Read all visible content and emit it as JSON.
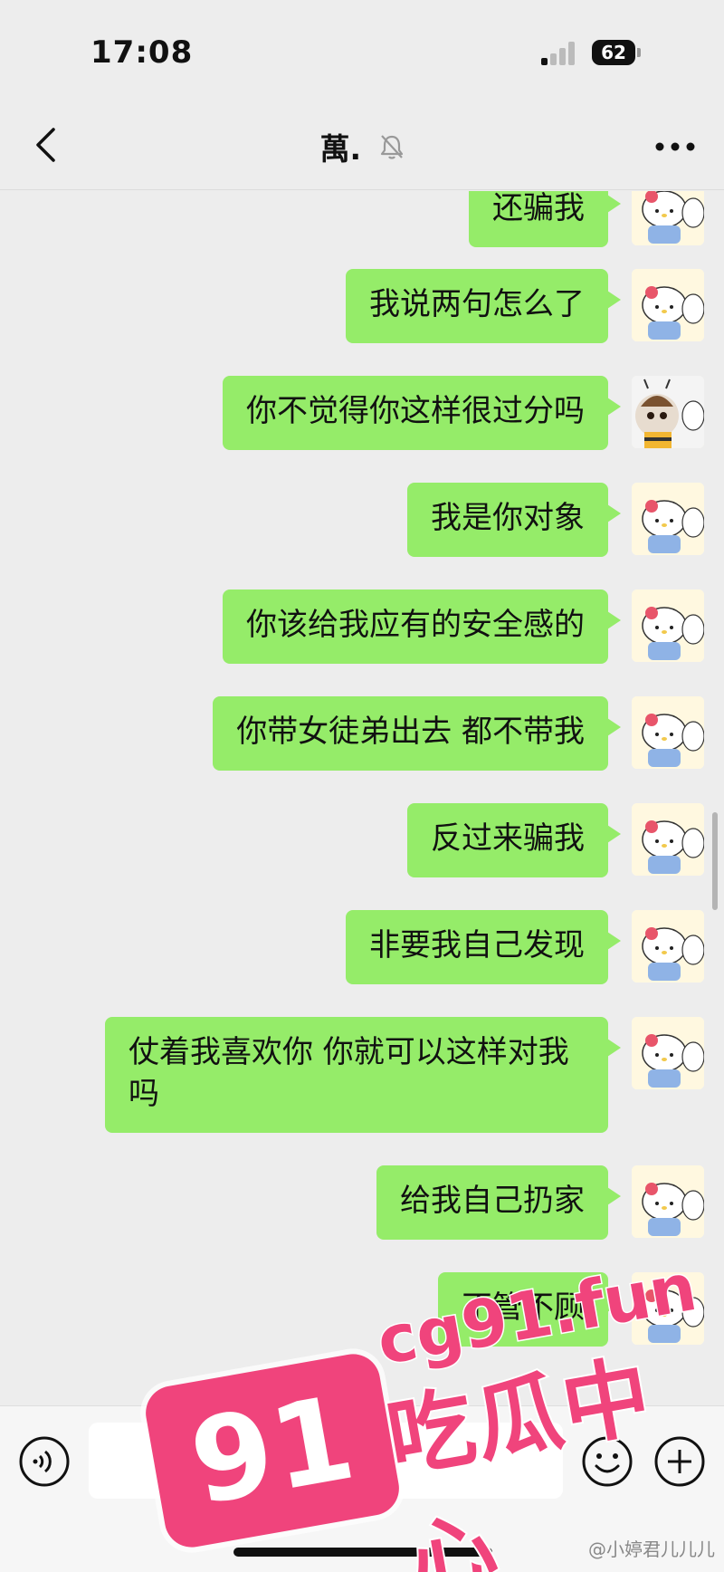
{
  "status_bar": {
    "time": "17:08",
    "battery": "62"
  },
  "nav": {
    "title": "萬."
  },
  "messages": [
    {
      "text": "还骗我",
      "avatar": "hello-kitty-avatar"
    },
    {
      "text": "我说两句怎么了",
      "avatar": "hello-kitty-avatar"
    },
    {
      "text": "你不觉得你这样很过分吗",
      "avatar": "bee-kid-avatar"
    },
    {
      "text": "我是你对象",
      "avatar": "hello-kitty-avatar"
    },
    {
      "text": "你该给我应有的安全感的",
      "avatar": "hello-kitty-avatar"
    },
    {
      "text": "你带女徒弟出去 都不带我",
      "avatar": "hello-kitty-avatar"
    },
    {
      "text": "反过来骗我",
      "avatar": "hello-kitty-avatar"
    },
    {
      "text": "非要我自己发现",
      "avatar": "hello-kitty-avatar"
    },
    {
      "text": "仗着我喜欢你 你就可以这样对我吗",
      "avatar": "hello-kitty-avatar"
    },
    {
      "text": "给我自己扔家",
      "avatar": "hello-kitty-avatar"
    },
    {
      "text": "不管不顾",
      "avatar": "hello-kitty-avatar"
    }
  ],
  "watermark": {
    "badge": "91",
    "domain": "cg91.fun",
    "label": "吃瓜中心"
  },
  "credit": "@小婷君儿儿儿",
  "colors": {
    "bubble": "#95ec69",
    "background": "#ededed",
    "watermark": "#f0447c"
  }
}
